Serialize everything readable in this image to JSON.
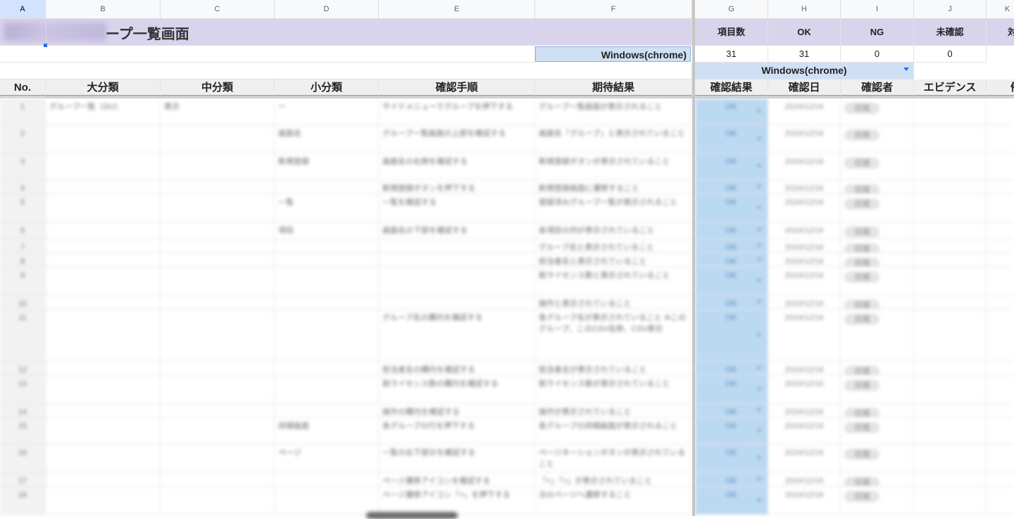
{
  "column_letters": [
    "A",
    "B",
    "C",
    "D",
    "E",
    "F",
    "G",
    "H",
    "I",
    "J",
    "K"
  ],
  "title_visible": "ープ一覧画面",
  "stats": {
    "headers": [
      "項目数",
      "OK",
      "NG",
      "未確認",
      "対"
    ],
    "env_label": "Windows(chrome)",
    "values": [
      "31",
      "31",
      "0",
      "0"
    ]
  },
  "env_merged_label": "Windows(chrome)",
  "table_headers": [
    "No.",
    "大分類",
    "中分類",
    "小分類",
    "確認手順",
    "期待結果",
    "確認結果",
    "確認日",
    "確認者",
    "エビデンス",
    "備"
  ],
  "rows": [
    {
      "no": "1",
      "c1": "グループ一覧（GU）",
      "c2": "表示",
      "c3": "ー",
      "step": "サイドメニューでグループを押下する",
      "expect": "グループ一覧画面が表示されること",
      "result": "OK",
      "date": "2024/12/16",
      "checker": "日城"
    },
    {
      "no": "2",
      "c1": "",
      "c2": "",
      "c3": "画面名",
      "step": "グループ一覧画面の上部を確認する",
      "expect": "画面名「グループ」と表示されていること",
      "result": "OK",
      "date": "2024/12/16",
      "checker": "日城"
    },
    {
      "no": "3",
      "c1": "",
      "c2": "",
      "c3": "新規登録",
      "step": "画面名の右側を確認する",
      "expect": "新規登録ボタンが表示されていること",
      "result": "OK",
      "date": "2024/12/16",
      "checker": "日城"
    },
    {
      "no": "4",
      "c1": "",
      "c2": "",
      "c3": "",
      "step": "新規登録ボタンを押下する",
      "expect": "新規登録画面に遷移すること",
      "result": "OK",
      "date": "2024/12/16",
      "checker": "日城"
    },
    {
      "no": "5",
      "c1": "",
      "c2": "",
      "c3": "一覧",
      "step": "一覧を確認する",
      "expect": "登録済みグループ一覧が表示されること",
      "result": "OK",
      "date": "2024/12/16",
      "checker": "日城"
    },
    {
      "no": "6",
      "c1": "",
      "c2": "",
      "c3": "項目",
      "step": "画面名の下部を確認する",
      "expect": "各項目の列が表示されていること",
      "result": "OK",
      "date": "2024/12/16",
      "checker": "日城"
    },
    {
      "no": "7",
      "c1": "",
      "c2": "",
      "c3": "",
      "step": "",
      "expect": "グループ名と表示されていること",
      "result": "OK",
      "date": "2024/12/16",
      "checker": "日城"
    },
    {
      "no": "8",
      "c1": "",
      "c2": "",
      "c3": "",
      "step": "",
      "expect": "担当者名と表示されていること",
      "result": "OK",
      "date": "2024/12/16",
      "checker": "日城"
    },
    {
      "no": "9",
      "c1": "",
      "c2": "",
      "c3": "",
      "step": "",
      "expect": "割ライセンス数と表示されていること",
      "result": "OK",
      "date": "2024/12/16",
      "checker": "日城"
    },
    {
      "no": "10",
      "c1": "",
      "c2": "",
      "c3": "",
      "step": "",
      "expect": "操作と表示されていること",
      "result": "OK",
      "date": "2024/12/16",
      "checker": "日城"
    },
    {
      "no": "11",
      "c1": "",
      "c2": "",
      "c3": "",
      "step": "グループ名の欄内を確認する",
      "expect": "各グループ名が表示されていること ※このグループ、このCSV名称、CSV表示",
      "result": "OK",
      "date": "2024/12/16",
      "checker": "日城"
    },
    {
      "no": "12",
      "c1": "",
      "c2": "",
      "c3": "",
      "step": "担当者名の欄内を確認する",
      "expect": "担当者名が表示されていること",
      "result": "OK",
      "date": "2024/12/16",
      "checker": "日城"
    },
    {
      "no": "13",
      "c1": "",
      "c2": "",
      "c3": "",
      "step": "割ライセンス数の欄内を確認する",
      "expect": "割ライセンス数が表示されていること",
      "result": "OK",
      "date": "2024/12/16",
      "checker": "日城"
    },
    {
      "no": "14",
      "c1": "",
      "c2": "",
      "c3": "",
      "step": "操作の欄内を確認する",
      "expect": "操作が表示されていること",
      "result": "OK",
      "date": "2024/12/16",
      "checker": "日城"
    },
    {
      "no": "15",
      "c1": "",
      "c2": "",
      "c3": "詳細画面",
      "step": "各グループの行を押下する",
      "expect": "各グループの詳細画面が表示されること",
      "result": "OK",
      "date": "2024/12/16",
      "checker": "日城"
    },
    {
      "no": "16",
      "c1": "",
      "c2": "",
      "c3": "ページ",
      "step": "一覧の右下部分を確認する",
      "expect": "ページネーションボタンが表示されていること",
      "result": "OK",
      "date": "2024/12/16",
      "checker": "日城"
    },
    {
      "no": "17",
      "c1": "",
      "c2": "",
      "c3": "",
      "step": "ページ遷移アイコンを確認する",
      "expect": "「<」「>」が表示されていること",
      "result": "OK",
      "date": "2024/12/16",
      "checker": "日城"
    },
    {
      "no": "18",
      "c1": "",
      "c2": "",
      "c3": "",
      "step": "ページ遷移アイコン「>」を押下する",
      "expect": "次のページへ遷移すること",
      "result": "OK",
      "date": "2024/12/16",
      "checker": "日城"
    }
  ]
}
